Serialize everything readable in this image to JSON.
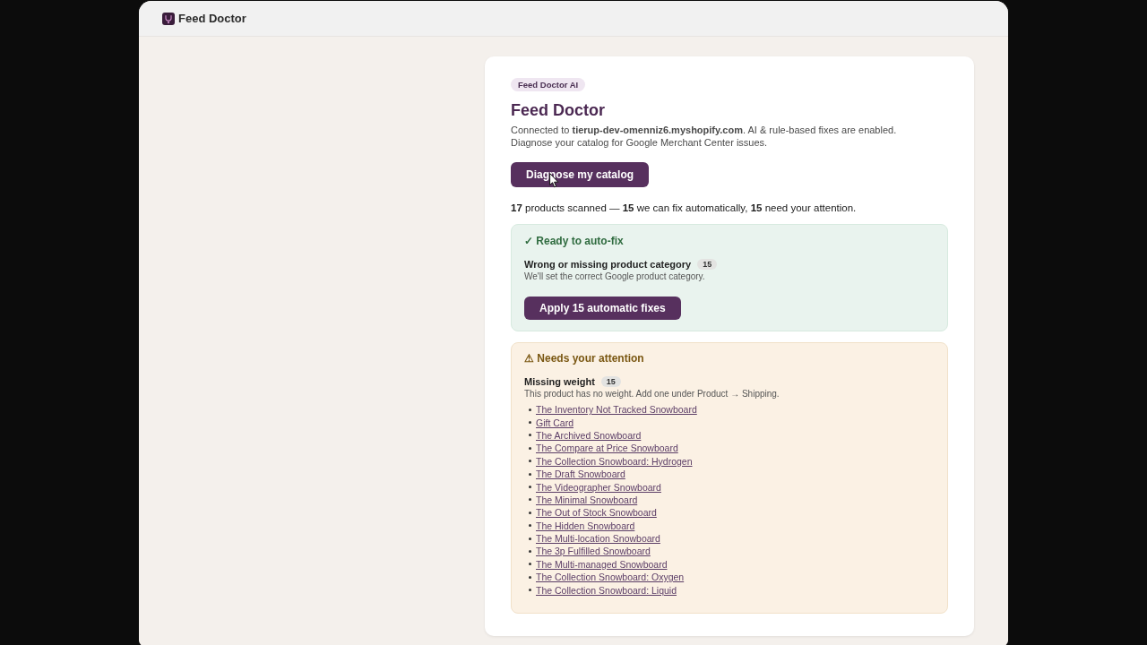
{
  "app": {
    "title": "Feed Doctor"
  },
  "card": {
    "badge": "Feed Doctor AI",
    "title": "Feed Doctor",
    "description": "Connected to **tierup-dev-omenniz6.myshopify.com**. AI & rule-based fixes are enabled. Diagnose your catalog for Google Merchant Center issues.",
    "primary_button": "Diagnose my catalog",
    "summary": "**17** products scanned — **15** we can fix automatically, **15** need your attention.",
    "sections": [
      {
        "kind": "success",
        "heading": "✓ Ready to auto-fix",
        "issues": [
          {
            "title": "Wrong or missing product category",
            "count": "15",
            "description": "We'll set the correct Google product category."
          }
        ],
        "button": "Apply 15 automatic fixes"
      },
      {
        "kind": "warning",
        "heading": "⚠ Needs your attention",
        "issues": [
          {
            "title": "Missing weight",
            "count": "15",
            "description": "This product has no weight. Add one under Product → Shipping.",
            "products": [
              "The Inventory Not Tracked Snowboard",
              "Gift Card",
              "The Archived Snowboard",
              "The Compare at Price Snowboard",
              "The Collection Snowboard: Hydrogen",
              "The Draft Snowboard",
              "The Videographer Snowboard",
              "The Minimal Snowboard",
              "The Out of Stock Snowboard",
              "The Hidden Snowboard",
              "The Multi-location Snowboard",
              "The 3p Fulfilled Snowboard",
              "The Multi-managed Snowboard",
              "The Collection Snowboard: Oxygen",
              "The Collection Snowboard: Liquid"
            ]
          }
        ]
      }
    ]
  }
}
